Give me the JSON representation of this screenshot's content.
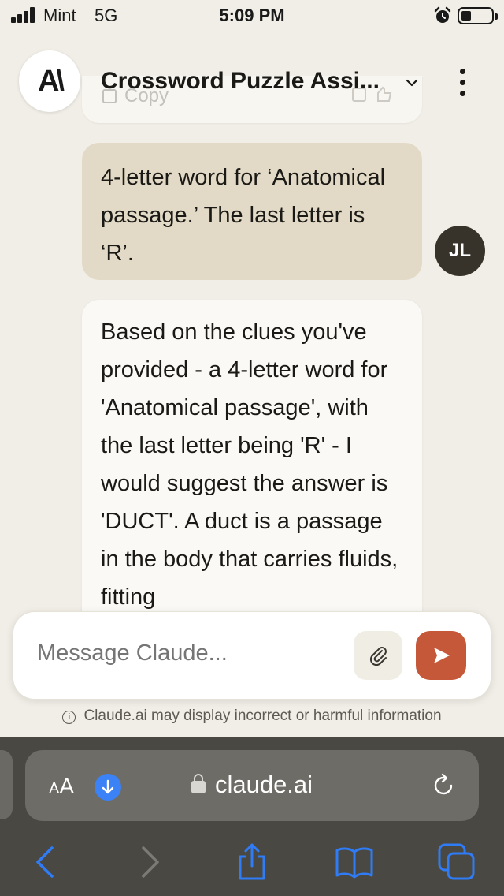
{
  "status_bar": {
    "carrier": "Mint",
    "network": "5G",
    "time": "5:09 PM",
    "signal_bars": 4,
    "battery_level": 0.25
  },
  "header": {
    "logo_text": "A\\",
    "chat_title": "Crossword Puzzle Assi...",
    "title_menu_icon": "chevron-down-icon",
    "more_icon": "more-vertical-icon"
  },
  "previous_message": {
    "copy_label": "Copy"
  },
  "messages": {
    "user": {
      "text": "4-letter word for ‘Anatomical passage.’ The last letter is ‘R’.",
      "avatar_initials": "JL"
    },
    "assistant": {
      "text": "Based on the clues you've provided - a 4-letter word for 'Anatomical passage', with the last letter being 'R' - I would suggest the answer is 'DUCT'. A duct is a passage in the body that carries fluids, fitting"
    }
  },
  "composer": {
    "placeholder": "Message Claude...",
    "attach_icon": "paperclip-icon",
    "send_icon": "send-arrow-icon"
  },
  "disclaimer": {
    "text": "Claude.ai may display incorrect or harmful information"
  },
  "browser": {
    "aa_label_small": "A",
    "aa_label_large": "A",
    "url": "claude.ai",
    "toolbar": [
      "back-icon",
      "forward-icon",
      "share-icon",
      "bookmarks-icon",
      "tabs-icon"
    ]
  },
  "colors": {
    "background": "#f0eee6",
    "user_bubble": "#e2dac6",
    "assistant_bubble": "#faf9f5",
    "send_button": "#c6583a",
    "avatar": "#37322a",
    "browser_chrome": "#4a4843",
    "ios_blue": "#2f7cf6"
  }
}
